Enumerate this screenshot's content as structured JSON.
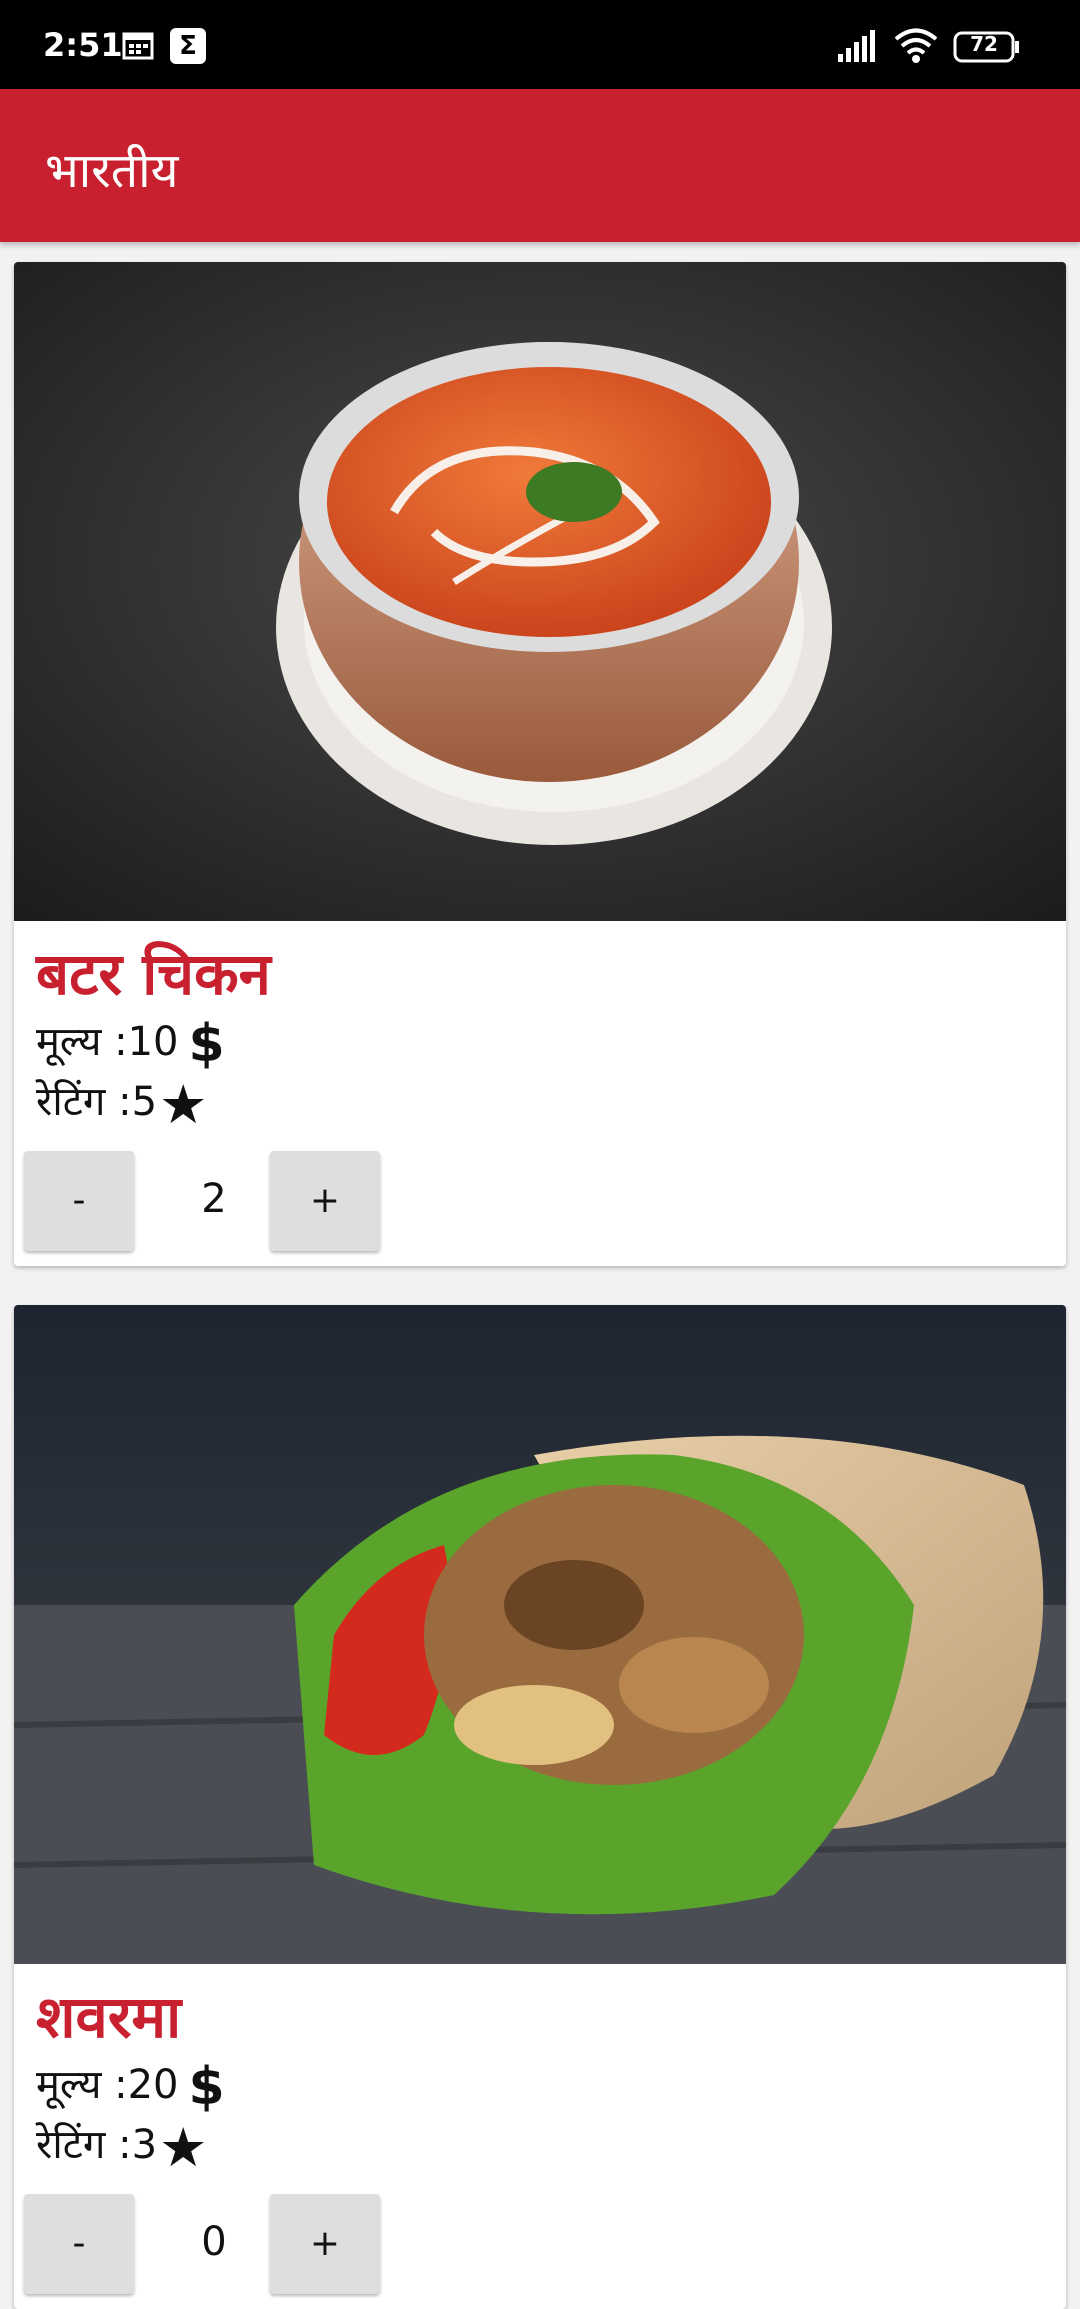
{
  "status_bar": {
    "time": "2:51",
    "battery": "72",
    "icons": [
      "calendar-icon",
      "sigma-icon",
      "signal-icon",
      "wifi-icon",
      "battery-icon"
    ]
  },
  "app_bar": {
    "title": "भारतीय"
  },
  "colors": {
    "accent": "#c8202f",
    "status_bar": "#000000",
    "button": "#dedede"
  },
  "items": [
    {
      "name": "बटर चिकन",
      "price_label": "मूल्य :10",
      "currency": "$",
      "rating_label": "रेटिंग :5",
      "rating_icon": "★",
      "minus": "-",
      "quantity": "2",
      "plus": "+"
    },
    {
      "name": "शवरमा",
      "price_label": "मूल्य :20",
      "currency": "$",
      "rating_label": "रेटिंग :3",
      "rating_icon": "★",
      "minus": "-",
      "quantity": "0",
      "plus": "+"
    }
  ]
}
